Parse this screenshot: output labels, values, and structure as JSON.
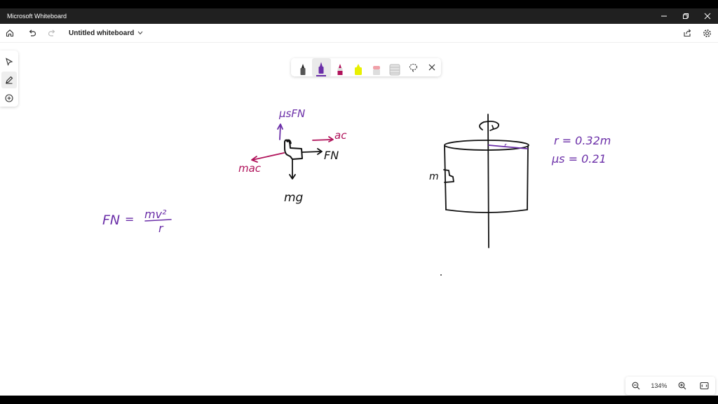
{
  "window": {
    "title": "Microsoft Whiteboard"
  },
  "toolbar": {
    "document_title": "Untitled whiteboard"
  },
  "left_rail": {
    "tools": [
      "select-tool",
      "inking-tool",
      "add-tool"
    ]
  },
  "pen_tray": {
    "pens": [
      {
        "name": "black-pen",
        "color": "#222222"
      },
      {
        "name": "purple-pen",
        "color": "#6b2fa8",
        "selected": true
      },
      {
        "name": "magenta-pen",
        "color": "#b0125a"
      },
      {
        "name": "yellow-highlighter",
        "color": "#e8f000"
      },
      {
        "name": "eraser",
        "color": "#f0a0a8"
      },
      {
        "name": "ruler",
        "color": "#bdbdbd"
      }
    ]
  },
  "zoom": {
    "value": "134%"
  },
  "colors": {
    "purple_ink": "#6b2fa8",
    "magenta_ink": "#b0125a",
    "black_ink": "#111111"
  },
  "ink": {
    "mu_s_F_N": "μsFN",
    "a_c": "ac",
    "F_N": "FN",
    "m_a_c": "mac",
    "mg": "mg",
    "eq_lhs": "FN",
    "eq_equals": "=",
    "eq_numerator": "mv²",
    "eq_denominator": "r",
    "m_label": "m",
    "r_label": "r",
    "radius": "r = 0.32m",
    "mu_s": "μs = 0.21"
  }
}
